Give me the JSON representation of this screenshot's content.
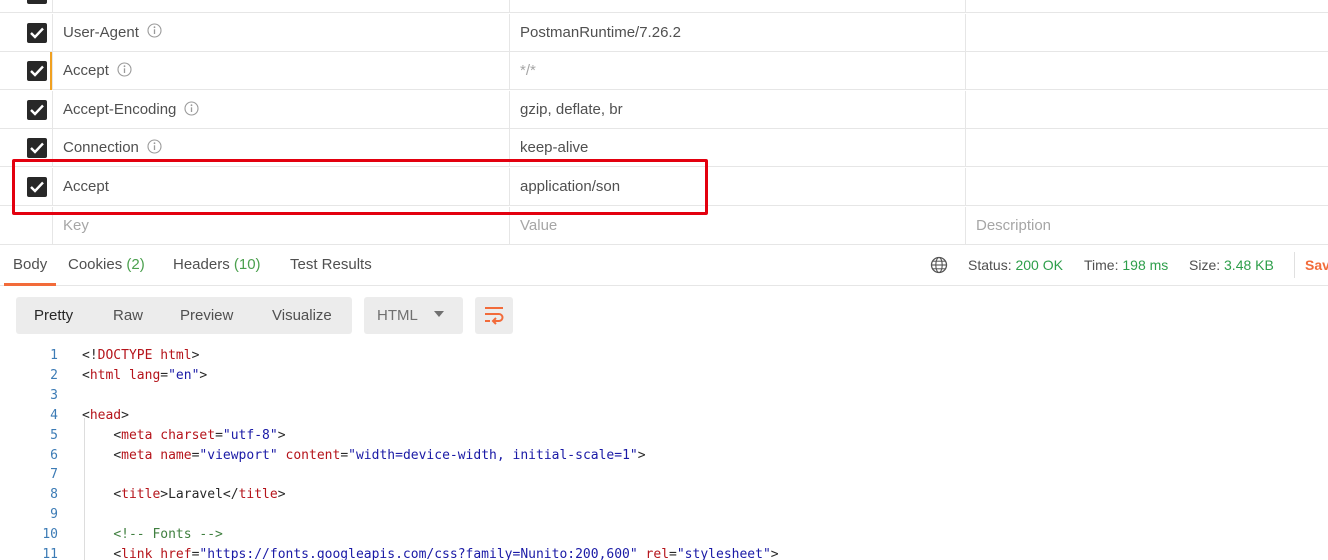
{
  "headers": [
    {
      "checked": true,
      "key": "",
      "value": "",
      "description": "",
      "info": false
    },
    {
      "checked": true,
      "key": "User-Agent",
      "value": "PostmanRuntime/7.26.2",
      "description": "",
      "info": true
    },
    {
      "checked": true,
      "key": "Accept",
      "value": "*/*",
      "description": "",
      "info": true,
      "value_muted": true,
      "accent": true
    },
    {
      "checked": true,
      "key": "Accept-Encoding",
      "value": "gzip, deflate, br",
      "description": "",
      "info": true
    },
    {
      "checked": true,
      "key": "Connection",
      "value": "keep-alive",
      "description": "",
      "info": true
    },
    {
      "checked": true,
      "key": "Accept",
      "value": "application/son",
      "description": "",
      "info": false,
      "highlighted": true
    }
  ],
  "new_row": {
    "key_placeholder": "Key",
    "value_placeholder": "Value",
    "description_placeholder": "Description"
  },
  "response_tabs": {
    "body": "Body",
    "cookies": "Cookies",
    "cookies_count": "(2)",
    "headers": "Headers",
    "headers_count": "(10)",
    "tests": "Test Results"
  },
  "status": {
    "status_label": "Status:",
    "status_value": "200 OK",
    "time_label": "Time:",
    "time_value": "198 ms",
    "size_label": "Size:",
    "size_value": "3.48 KB",
    "save_label": "Sav"
  },
  "view": {
    "pretty": "Pretty",
    "raw": "Raw",
    "preview": "Preview",
    "visualize": "Visualize",
    "format": "HTML"
  },
  "code_lines": [
    {
      "n": "1",
      "tokens": [
        [
          "tag",
          "<!"
        ],
        [
          "name",
          "DOCTYPE html"
        ],
        [
          "tag",
          ">"
        ]
      ]
    },
    {
      "n": "2",
      "tokens": [
        [
          "tag",
          "<"
        ],
        [
          "name",
          "html"
        ],
        [
          "text",
          " "
        ],
        [
          "attr",
          "lang"
        ],
        [
          "tag",
          "="
        ],
        [
          "str",
          "\"en\""
        ],
        [
          "tag",
          ">"
        ]
      ]
    },
    {
      "n": "3",
      "tokens": []
    },
    {
      "n": "4",
      "tokens": [
        [
          "tag",
          "<"
        ],
        [
          "name",
          "head"
        ],
        [
          "tag",
          ">"
        ]
      ]
    },
    {
      "n": "5",
      "tokens": [
        [
          "text",
          "    "
        ],
        [
          "tag",
          "<"
        ],
        [
          "name",
          "meta"
        ],
        [
          "text",
          " "
        ],
        [
          "attr",
          "charset"
        ],
        [
          "tag",
          "="
        ],
        [
          "str",
          "\"utf-8\""
        ],
        [
          "tag",
          ">"
        ]
      ]
    },
    {
      "n": "6",
      "tokens": [
        [
          "text",
          "    "
        ],
        [
          "tag",
          "<"
        ],
        [
          "name",
          "meta"
        ],
        [
          "text",
          " "
        ],
        [
          "attr",
          "name"
        ],
        [
          "tag",
          "="
        ],
        [
          "str",
          "\"viewport\""
        ],
        [
          "text",
          " "
        ],
        [
          "attr",
          "content"
        ],
        [
          "tag",
          "="
        ],
        [
          "str",
          "\"width=device-width, initial-scale=1\""
        ],
        [
          "tag",
          ">"
        ]
      ]
    },
    {
      "n": "7",
      "tokens": []
    },
    {
      "n": "8",
      "tokens": [
        [
          "text",
          "    "
        ],
        [
          "tag",
          "<"
        ],
        [
          "name",
          "title"
        ],
        [
          "tag",
          ">"
        ],
        [
          "text",
          "Laravel"
        ],
        [
          "tag",
          "</"
        ],
        [
          "name",
          "title"
        ],
        [
          "tag",
          ">"
        ]
      ]
    },
    {
      "n": "9",
      "tokens": []
    },
    {
      "n": "10",
      "tokens": [
        [
          "text",
          "    "
        ],
        [
          "cmt",
          "<!-- Fonts -->"
        ]
      ]
    },
    {
      "n": "11",
      "tokens": [
        [
          "text",
          "    "
        ],
        [
          "tag",
          "<"
        ],
        [
          "name",
          "link"
        ],
        [
          "text",
          " "
        ],
        [
          "attr",
          "href"
        ],
        [
          "tag",
          "="
        ],
        [
          "str",
          "\"https://fonts.googleapis.com/css?family=Nunito:200,600\""
        ],
        [
          "text",
          " "
        ],
        [
          "attr",
          "rel"
        ],
        [
          "tag",
          "="
        ],
        [
          "str",
          "\"stylesheet\""
        ],
        [
          "tag",
          ">"
        ]
      ]
    }
  ]
}
